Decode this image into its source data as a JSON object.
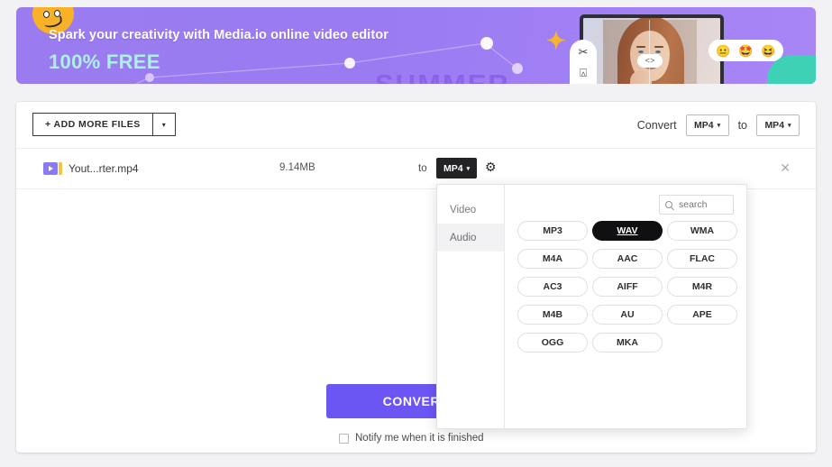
{
  "banner": {
    "headline": "Spark your creativity with Media.io online video editor",
    "subline": "100% FREE",
    "background_word": "SUMMER",
    "star_icon": "star-icon",
    "smiley_icon": "smiley-face-icon",
    "tools": [
      "scissors-icon",
      "crop-icon"
    ],
    "code_badge": "<>",
    "emojis": [
      "😐",
      "🤩",
      "😆"
    ],
    "accent_purple": "#9b7cf0",
    "accent_mint": "#a8f3e5",
    "accent_teal": "#3ed1b5"
  },
  "toolbar": {
    "add_more_files_label": "+ ADD MORE FILES",
    "add_more_caret": "▾",
    "convert_label": "Convert",
    "from_format": "MP4",
    "to_word": "to",
    "to_format": "MP4",
    "caret": "▾"
  },
  "file_row": {
    "name": "Yout...rter.mp4",
    "size": "9.14MB",
    "to_word": "to",
    "target_format": "MP4",
    "caret": "▾",
    "settings_icon": "gear-icon",
    "remove_icon": "close-icon"
  },
  "actions": {
    "convert_button_label": "CONVERT",
    "notify_label": "Notify me when it is finished",
    "notify_checked": false,
    "convert_color": "#6c56f3"
  },
  "format_panel": {
    "categories": [
      {
        "label": "Video",
        "active": false
      },
      {
        "label": "Audio",
        "active": true
      }
    ],
    "search": {
      "placeholder": "search",
      "value": "",
      "icon": "search-icon"
    },
    "selected_format": "WAV",
    "formats": [
      "MP3",
      "WAV",
      "WMA",
      "M4A",
      "AAC",
      "FLAC",
      "AC3",
      "AIFF",
      "M4R",
      "M4B",
      "AU",
      "APE",
      "OGG",
      "MKA"
    ]
  }
}
